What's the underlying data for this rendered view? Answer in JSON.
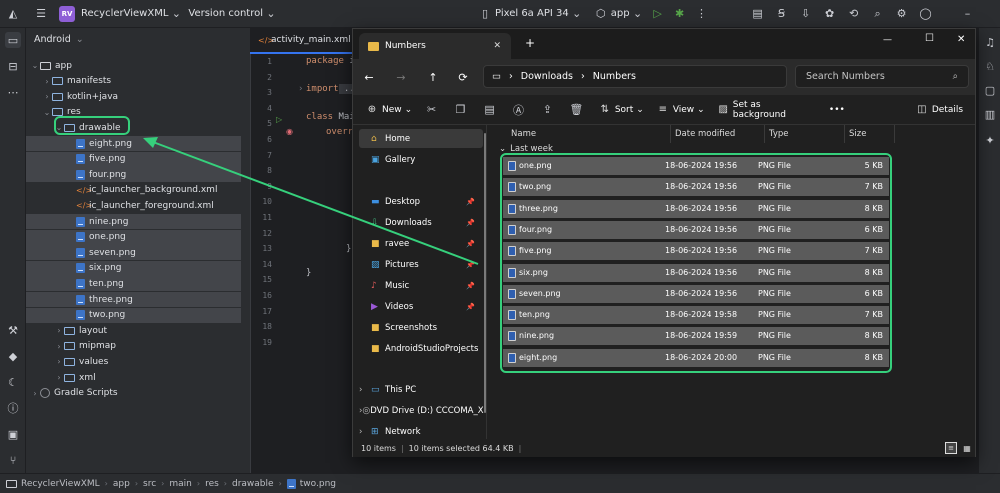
{
  "ide": {
    "app_badge": "RV",
    "project_name": "RecyclerViewXML",
    "version_control": "Version control",
    "device": "Pixel 6a API 34",
    "run_config": "app",
    "panel_title": "Android",
    "editor_tab": "activity_main.xml"
  },
  "tree": [
    {
      "label": "app",
      "indent": 1,
      "arrow": "⌄",
      "kind": "module"
    },
    {
      "label": "manifests",
      "indent": 2,
      "arrow": "›",
      "kind": "folder"
    },
    {
      "label": "kotlin+java",
      "indent": 2,
      "arrow": "›",
      "kind": "folder"
    },
    {
      "label": "res",
      "indent": 2,
      "arrow": "⌄",
      "kind": "folder"
    },
    {
      "label": "drawable",
      "indent": 3,
      "arrow": "⌄",
      "kind": "folder",
      "highlight": true
    },
    {
      "label": "eight.png",
      "indent": 4,
      "arrow": "",
      "kind": "png",
      "selected": true
    },
    {
      "label": "five.png",
      "indent": 4,
      "arrow": "",
      "kind": "png",
      "selected": true
    },
    {
      "label": "four.png",
      "indent": 4,
      "arrow": "",
      "kind": "png",
      "selected": true
    },
    {
      "label": "ic_launcher_background.xml",
      "indent": 4,
      "arrow": "",
      "kind": "xml"
    },
    {
      "label": "ic_launcher_foreground.xml",
      "indent": 4,
      "arrow": "",
      "kind": "xml"
    },
    {
      "label": "nine.png",
      "indent": 4,
      "arrow": "",
      "kind": "png",
      "selected": true
    },
    {
      "label": "one.png",
      "indent": 4,
      "arrow": "",
      "kind": "png",
      "selected": true
    },
    {
      "label": "seven.png",
      "indent": 4,
      "arrow": "",
      "kind": "png",
      "selected": true
    },
    {
      "label": "six.png",
      "indent": 4,
      "arrow": "",
      "kind": "png",
      "selected": true
    },
    {
      "label": "ten.png",
      "indent": 4,
      "arrow": "",
      "kind": "png",
      "selected": true
    },
    {
      "label": "three.png",
      "indent": 4,
      "arrow": "",
      "kind": "png",
      "selected": true
    },
    {
      "label": "two.png",
      "indent": 4,
      "arrow": "",
      "kind": "png",
      "selected": true
    },
    {
      "label": "layout",
      "indent": 3,
      "arrow": "›",
      "kind": "folder"
    },
    {
      "label": "mipmap",
      "indent": 3,
      "arrow": "›",
      "kind": "folder"
    },
    {
      "label": "values",
      "indent": 3,
      "arrow": "›",
      "kind": "folder"
    },
    {
      "label": "xml",
      "indent": 3,
      "arrow": "›",
      "kind": "folder"
    },
    {
      "label": "Gradle Scripts",
      "indent": 1,
      "arrow": "›",
      "kind": "gradle"
    }
  ],
  "code": {
    "line_numbers": [
      "1",
      "2",
      "3",
      "4",
      "5",
      "6",
      "7",
      "8",
      "9",
      "10",
      "11",
      "12",
      "13",
      "14",
      "15",
      "16",
      "17",
      "18",
      "19"
    ],
    "package_kw": "package",
    "package_rest": " i",
    "import_kw": "import",
    "import_rest": " ...",
    "class_kw": "class",
    "class_rest": " Mai",
    "override_frag": "overr",
    "close_1": "}",
    "close_2": "}"
  },
  "breadcrumb": [
    "RecyclerViewXML",
    "app",
    "src",
    "main",
    "res",
    "drawable",
    "two.png"
  ],
  "explorer": {
    "tab_title": "Numbers",
    "new_tab": "+",
    "minimize": "—",
    "maximize": "☐",
    "close": "✕",
    "path": [
      "Downloads",
      "Numbers"
    ],
    "search_placeholder": "Search Numbers",
    "commands": {
      "new": "New",
      "sort": "Sort",
      "view": "View",
      "background": "Set as background",
      "more": "•••",
      "details": "Details"
    },
    "nav": [
      {
        "label": "Home",
        "icon": "home-icon",
        "selected": true
      },
      {
        "label": "Gallery",
        "icon": "gallery-icon"
      },
      {
        "label": "Desktop",
        "icon": "desktop-icon",
        "pin": true
      },
      {
        "label": "Downloads",
        "icon": "download-icon",
        "pin": true
      },
      {
        "label": "ravee",
        "icon": "folder-icon",
        "pin": true
      },
      {
        "label": "Pictures",
        "icon": "pictures-icon",
        "pin": true
      },
      {
        "label": "Music",
        "icon": "music-icon",
        "pin": true
      },
      {
        "label": "Videos",
        "icon": "videos-icon",
        "pin": true
      },
      {
        "label": "Screenshots",
        "icon": "folder-icon"
      },
      {
        "label": "AndroidStudioProjects",
        "icon": "folder-icon"
      },
      {
        "label": "This PC",
        "icon": "pc-icon",
        "expand": true
      },
      {
        "label": "DVD Drive (D:) CCCOMA_X",
        "icon": "dvd-icon",
        "expand": true
      },
      {
        "label": "Network",
        "icon": "network-icon",
        "expand": true
      }
    ],
    "columns": {
      "name": "Name",
      "date": "Date modified",
      "type": "Type",
      "size": "Size"
    },
    "group": "Last week",
    "files": [
      {
        "name": "one.png",
        "date": "18-06-2024 19:56",
        "type": "PNG File",
        "size": "5 KB"
      },
      {
        "name": "two.png",
        "date": "18-06-2024 19:56",
        "type": "PNG File",
        "size": "7 KB"
      },
      {
        "name": "three.png",
        "date": "18-06-2024 19:56",
        "type": "PNG File",
        "size": "8 KB"
      },
      {
        "name": "four.png",
        "date": "18-06-2024 19:56",
        "type": "PNG File",
        "size": "6 KB"
      },
      {
        "name": "five.png",
        "date": "18-06-2024 19:56",
        "type": "PNG File",
        "size": "7 KB"
      },
      {
        "name": "six.png",
        "date": "18-06-2024 19:56",
        "type": "PNG File",
        "size": "8 KB"
      },
      {
        "name": "seven.png",
        "date": "18-06-2024 19:56",
        "type": "PNG File",
        "size": "6 KB"
      },
      {
        "name": "ten.png",
        "date": "18-06-2024 19:58",
        "type": "PNG File",
        "size": "7 KB"
      },
      {
        "name": "nine.png",
        "date": "18-06-2024 19:59",
        "type": "PNG File",
        "size": "8 KB"
      },
      {
        "name": "eight.png",
        "date": "18-06-2024 20:00",
        "type": "PNG File",
        "size": "8 KB"
      }
    ],
    "status": {
      "count": "10 items",
      "selected": "10 items selected  64.4 KB"
    }
  },
  "colors": {
    "highlight": "#36d07c",
    "ide_bg": "#1e1f22",
    "explorer_bg": "#202020"
  }
}
